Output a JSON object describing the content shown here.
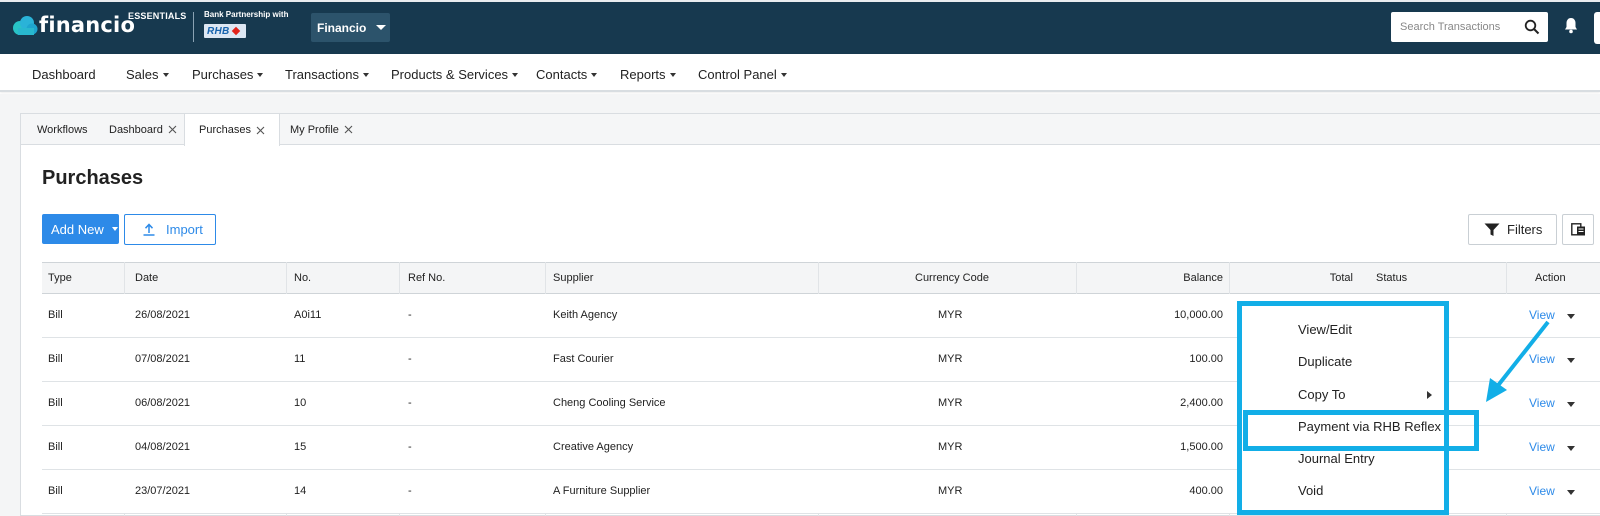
{
  "app": {
    "logo_text": "financio",
    "edition": "ESSENTIALS",
    "bank_partnership_label": "Bank Partnership with",
    "bank_logo_text": "RHB",
    "company_name": "Financio",
    "search_placeholder": "Search Transactions"
  },
  "main_nav": [
    {
      "label": "Dashboard",
      "dropdown": false
    },
    {
      "label": "Sales",
      "dropdown": true
    },
    {
      "label": "Purchases",
      "dropdown": true
    },
    {
      "label": "Transactions",
      "dropdown": true
    },
    {
      "label": "Products & Services",
      "dropdown": true
    },
    {
      "label": "Contacts",
      "dropdown": true
    },
    {
      "label": "Reports",
      "dropdown": true
    },
    {
      "label": "Control Panel",
      "dropdown": true
    }
  ],
  "tabs": [
    {
      "label": "Workflows",
      "closable": false,
      "active": false
    },
    {
      "label": "Dashboard",
      "closable": true,
      "active": false
    },
    {
      "label": "Purchases",
      "closable": true,
      "active": true
    },
    {
      "label": "My Profile",
      "closable": true,
      "active": false
    }
  ],
  "page": {
    "title": "Purchases",
    "add_new_label": "Add New",
    "import_label": "Import",
    "filters_label": "Filters"
  },
  "table": {
    "columns": [
      "Type",
      "Date",
      "No.",
      "Ref No.",
      "Supplier",
      "Currency Code",
      "Balance",
      "Total",
      "Status",
      "Action"
    ],
    "rows": [
      {
        "type": "Bill",
        "date": "26/08/2021",
        "no": "A0i11",
        "ref": "-",
        "supplier": "Keith Agency",
        "currency": "MYR",
        "balance": "10,000.00",
        "action": "View"
      },
      {
        "type": "Bill",
        "date": "07/08/2021",
        "no": "11",
        "ref": "-",
        "supplier": "Fast Courier",
        "currency": "MYR",
        "balance": "100.00",
        "action": "View"
      },
      {
        "type": "Bill",
        "date": "06/08/2021",
        "no": "10",
        "ref": "-",
        "supplier": "Cheng Cooling Service",
        "currency": "MYR",
        "balance": "2,400.00",
        "action": "View"
      },
      {
        "type": "Bill",
        "date": "04/08/2021",
        "no": "15",
        "ref": "-",
        "supplier": "Creative Agency",
        "currency": "MYR",
        "balance": "1,500.00",
        "action": "View"
      },
      {
        "type": "Bill",
        "date": "23/07/2021",
        "no": "14",
        "ref": "-",
        "supplier": "A Furniture Supplier",
        "currency": "MYR",
        "balance": "400.00",
        "action": "View"
      }
    ]
  },
  "context_menu": {
    "items": [
      "View/Edit",
      "Duplicate",
      "Copy To",
      "Payment via RHB Reflex",
      "Journal Entry",
      "Void"
    ],
    "highlighted_item": "Payment via RHB Reflex",
    "annotation_color": "#12aee7"
  },
  "colors": {
    "header_bg": "#17394f",
    "primary_blue": "#2d8ae8",
    "annotation_cyan": "#12aee7"
  }
}
